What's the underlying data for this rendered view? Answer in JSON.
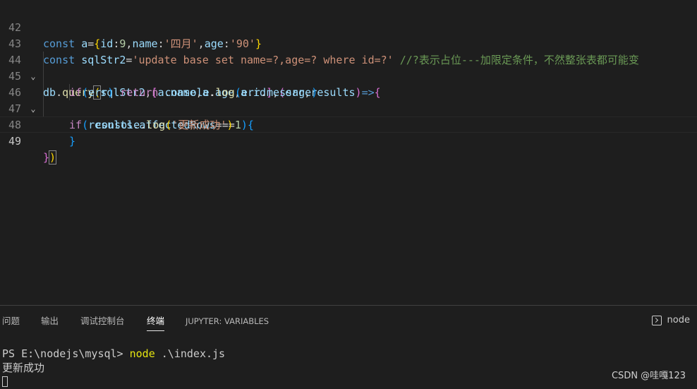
{
  "editor": {
    "lines": [
      {
        "num": "42",
        "fold": ""
      },
      {
        "num": "43",
        "fold": ""
      },
      {
        "num": "44",
        "fold": "⌄"
      },
      {
        "num": "45",
        "fold": ""
      },
      {
        "num": "46",
        "fold": "⌄"
      },
      {
        "num": "47",
        "fold": ""
      },
      {
        "num": "48",
        "fold": ""
      },
      {
        "num": "49",
        "fold": ""
      }
    ],
    "tokens": {
      "l42": [
        "const",
        "a",
        "=",
        "{",
        "id",
        ":",
        "9",
        ",",
        "name",
        ":",
        "'四月'",
        ",",
        "age",
        ":",
        "'90'",
        "}"
      ],
      "l43": [
        "const",
        "sqlStr2",
        "=",
        "'update base set name=?,age=? where id=?'",
        " //?表示占位---加限定条件，不然整张表都可能变"
      ],
      "l44": [
        "db",
        ".",
        "query",
        "(",
        "sqlStr2",
        ",",
        "[",
        "a",
        ".",
        "name",
        ",",
        "a",
        ".",
        "age",
        ",",
        "a",
        ".",
        "id",
        "]",
        ",",
        "(",
        "err",
        ",",
        "results",
        ")",
        "=>",
        "{"
      ],
      "l45": [
        "if",
        "(",
        "err",
        ")",
        "return",
        "console",
        ".",
        "log",
        "(",
        "err",
        ".",
        "message",
        ")"
      ],
      "l46": [
        "if",
        "(",
        "results",
        ".",
        "affectedRows",
        "===",
        "1",
        ")",
        "{"
      ],
      "l47": [
        "console",
        ".",
        "log",
        "(",
        "'更新成功'",
        ")"
      ],
      "l48": [
        "}"
      ],
      "l49": [
        "}",
        ")"
      ]
    }
  },
  "panel": {
    "tabs": [
      "问题",
      "输出",
      "调试控制台",
      "终端",
      "JUPYTER: VARIABLES"
    ],
    "active_tab": "终端",
    "terminal_selector": "node",
    "terminal": {
      "prompt": "PS E:\\nodejs\\mysql> ",
      "command": "node",
      "args": " .\\index.js",
      "output": "更新成功"
    }
  },
  "watermark": "CSDN @哇嘎123"
}
